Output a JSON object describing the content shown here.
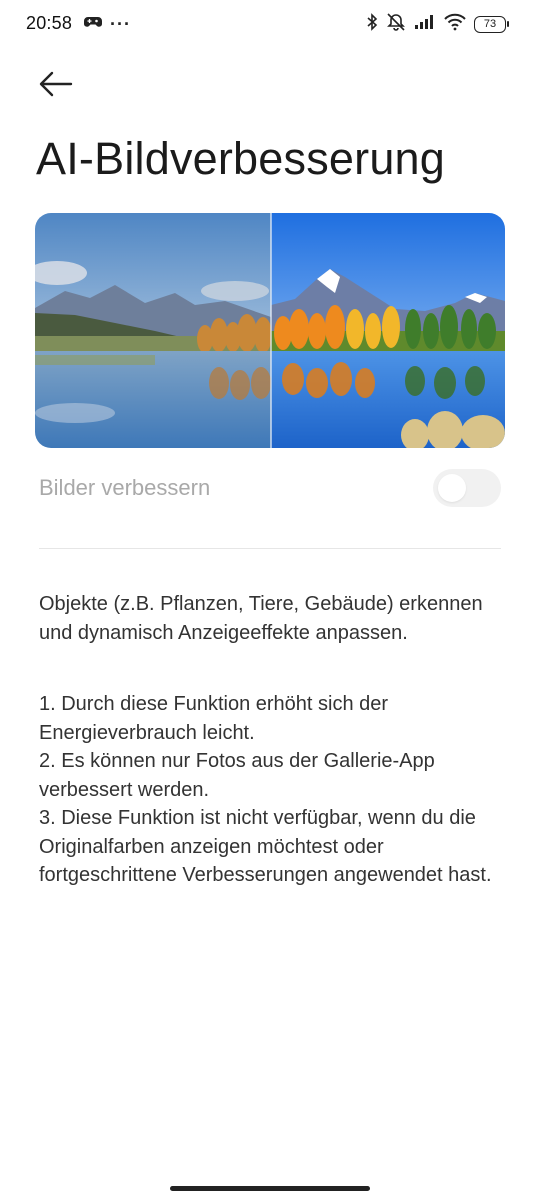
{
  "status_bar": {
    "time": "20:58",
    "overflow_dots": "···",
    "battery_level": "73"
  },
  "header": {
    "title": "AI-Bildverbesserung"
  },
  "toggle": {
    "label": "Bilder verbessern",
    "enabled": false
  },
  "description": "Objekte (z.B. Pflanzen, Tiere, Gebäude) erkennen und dynamisch Anzeigeeffekte anpassen.",
  "notes": [
    "1. Durch diese Funktion erhöht sich der Energieverbrauch leicht.",
    "2. Es können nur Fotos aus der Gallerie-App verbessert werden.",
    "3. Diese Funktion ist nicht verfügbar, wenn du die Originalfarben anzeigen möchtest oder fortgeschrittene Verbesserungen angewendet hast."
  ],
  "colors": {
    "accent_sky_enhanced": "#2f7fe0",
    "accent_sky_original": "#5b8fc6",
    "toggle_off_track": "#f1f1f1",
    "text_disabled": "#a9a9a9"
  }
}
